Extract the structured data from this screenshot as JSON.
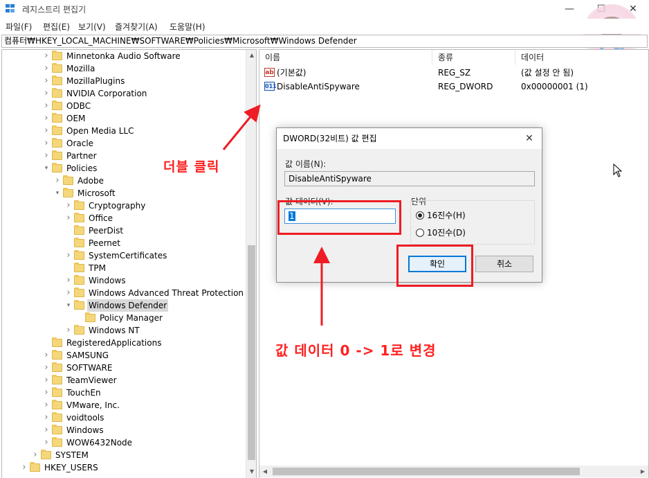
{
  "window": {
    "title": "레지스트리 편집기",
    "minimize": "—",
    "maximize": "☐",
    "close": "✕"
  },
  "watermark": {
    "text": "PC"
  },
  "menu": [
    "파일(F)",
    "편집(E)",
    "보기(V)",
    "즐겨찾기(A)",
    "도움말(H)"
  ],
  "address": "컴퓨터₩HKEY_LOCAL_MACHINE₩SOFTWARE₩Policies₩Microsoft₩Windows Defender",
  "tree": [
    {
      "label": "Minnetonka Audio Software",
      "level": 2,
      "chev": ">",
      "folder": true
    },
    {
      "label": "Mozilla",
      "level": 2,
      "chev": ">",
      "folder": true
    },
    {
      "label": "MozillaPlugins",
      "level": 2,
      "chev": ">",
      "folder": true
    },
    {
      "label": "NVIDIA Corporation",
      "level": 2,
      "chev": ">",
      "folder": true
    },
    {
      "label": "ODBC",
      "level": 2,
      "chev": ">",
      "folder": true
    },
    {
      "label": "OEM",
      "level": 2,
      "chev": ">",
      "folder": true
    },
    {
      "label": "Open Media LLC",
      "level": 2,
      "chev": ">",
      "folder": true
    },
    {
      "label": "Oracle",
      "level": 2,
      "chev": ">",
      "folder": true
    },
    {
      "label": "Partner",
      "level": 2,
      "chev": ">",
      "folder": true
    },
    {
      "label": "Policies",
      "level": 2,
      "chev": "v",
      "folder": true
    },
    {
      "label": "Adobe",
      "level": 3,
      "chev": ">",
      "folder": true
    },
    {
      "label": "Microsoft",
      "level": 3,
      "chev": "v",
      "folder": true
    },
    {
      "label": "Cryptography",
      "level": 4,
      "chev": ">",
      "folder": true
    },
    {
      "label": "Office",
      "level": 4,
      "chev": ">",
      "folder": true
    },
    {
      "label": "PeerDist",
      "level": 4,
      "chev": "",
      "folder": true
    },
    {
      "label": "Peernet",
      "level": 4,
      "chev": "",
      "folder": true
    },
    {
      "label": "SystemCertificates",
      "level": 4,
      "chev": ">",
      "folder": true
    },
    {
      "label": "TPM",
      "level": 4,
      "chev": "",
      "folder": true
    },
    {
      "label": "Windows",
      "level": 4,
      "chev": ">",
      "folder": true
    },
    {
      "label": "Windows Advanced Threat Protection",
      "level": 4,
      "chev": ">",
      "folder": true
    },
    {
      "label": "Windows Defender",
      "level": 4,
      "chev": "v",
      "folder": true,
      "selected": true
    },
    {
      "label": "Policy Manager",
      "level": 5,
      "chev": "",
      "folder": true
    },
    {
      "label": "Windows NT",
      "level": 4,
      "chev": ">",
      "folder": true
    },
    {
      "label": "RegisteredApplications",
      "level": 2,
      "chev": "",
      "folder": true
    },
    {
      "label": "SAMSUNG",
      "level": 2,
      "chev": ">",
      "folder": true
    },
    {
      "label": "SOFTWARE",
      "level": 2,
      "chev": ">",
      "folder": true
    },
    {
      "label": "TeamViewer",
      "level": 2,
      "chev": ">",
      "folder": true
    },
    {
      "label": "TouchEn",
      "level": 2,
      "chev": ">",
      "folder": true
    },
    {
      "label": "VMware, Inc.",
      "level": 2,
      "chev": ">",
      "folder": true
    },
    {
      "label": "voidtools",
      "level": 2,
      "chev": ">",
      "folder": true
    },
    {
      "label": "Windows",
      "level": 2,
      "chev": ">",
      "folder": true
    },
    {
      "label": "WOW6432Node",
      "level": 2,
      "chev": ">",
      "folder": true
    },
    {
      "label": "SYSTEM",
      "level": 1,
      "chev": ">",
      "folder": true
    },
    {
      "label": "HKEY_USERS",
      "level": 0,
      "chev": ">",
      "folder": true
    }
  ],
  "list": {
    "columns": [
      "이름",
      "종류",
      "데이터"
    ],
    "rows": [
      {
        "icon": "string-value-icon",
        "icon_text": "ab",
        "name": "(기본값)",
        "type": "REG_SZ",
        "data": "(값 설정 안 됨)"
      },
      {
        "icon": "binary-value-icon",
        "icon_text": "011",
        "name": "DisableAntiSpyware",
        "type": "REG_DWORD",
        "data": "0x00000001 (1)"
      }
    ]
  },
  "dialog": {
    "title": "DWORD(32비트) 값 편집",
    "close": "✕",
    "name_label": "값 이름(N):",
    "name_value": "DisableAntiSpyware",
    "data_label": "값 데이터(V):",
    "data_value": "1",
    "base_label": "단위",
    "base_hex": "16진수(H)",
    "base_dec": "10진수(D)",
    "base_selected": "hex",
    "ok": "확인",
    "cancel": "취소"
  },
  "annotations": {
    "double_click": "더블 클릭",
    "change_value": "값 데이터 0 -> 1로 변경",
    "color": "#ee1c24"
  }
}
